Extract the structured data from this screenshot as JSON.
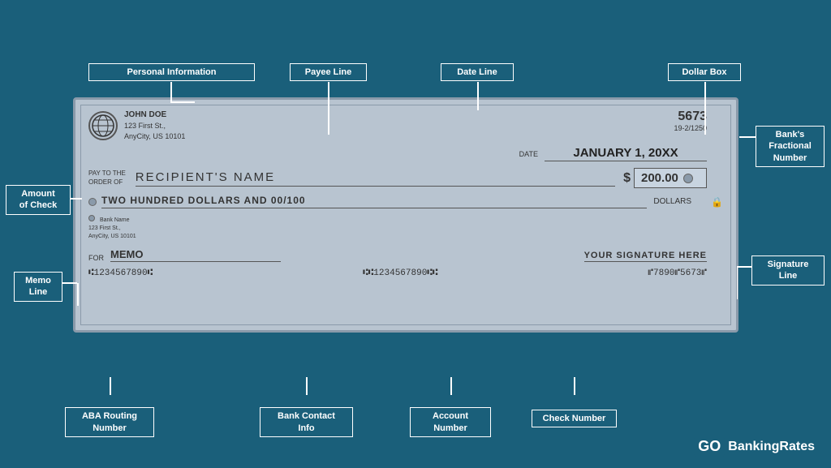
{
  "background_color": "#1a5f7a",
  "check": {
    "personal_info": {
      "name": "JOHN DOE",
      "address_line1": "123 First St.,",
      "address_line2": "AnyCity, US 10101"
    },
    "check_number": "5673",
    "fractional_number": "19-2/1250",
    "date_label": "DATE",
    "date_value": "JANUARY 1, 20XX",
    "pay_to_label_line1": "PAY TO THE",
    "pay_to_label_line2": "ORDER OF",
    "payee_name": "RECIPIENT'S NAME",
    "dollar_sign": "$",
    "amount": "200.00",
    "written_amount": "TWO HUNDRED DOLLARS AND 00/100",
    "dollars_label": "DOLLARS",
    "bank_name": "Bank Name",
    "bank_address1": "123 First St.,",
    "bank_address2": "AnyCity, US 10101",
    "memo_label": "FOR",
    "memo_value": "MEMO",
    "signature_text": "YOUR SIGNATURE HERE",
    "micr_routing": "⑆1234567890⑆",
    "micr_account": "⑆⑆1234567890⑆⑆",
    "micr_check": "⑈7890⑈5673⑈"
  },
  "labels": {
    "personal_information": "Personal Information",
    "payee_line": "Payee Line",
    "date_line": "Date Line",
    "dollar_box": "Dollar Box",
    "banks_fractional_number_line1": "Bank's",
    "banks_fractional_number_line2": "Fractional",
    "banks_fractional_number_line3": "Number",
    "amount_of_check_line1": "Amount",
    "amount_of_check_line2": "of Check",
    "memo_line": "Memo",
    "memo_line2": "Line",
    "signature_line_line1": "Signature",
    "signature_line_line2": "Line",
    "aba_routing_line1": "ABA Routing",
    "aba_routing_line2": "Number",
    "bank_contact_info_line1": "Bank Contact",
    "bank_contact_info_line2": "Info",
    "account_number_line1": "Account",
    "account_number_line2": "Number",
    "check_number_line1": "Check Number"
  },
  "branding": {
    "go": "GO",
    "text": "BankingRates"
  }
}
